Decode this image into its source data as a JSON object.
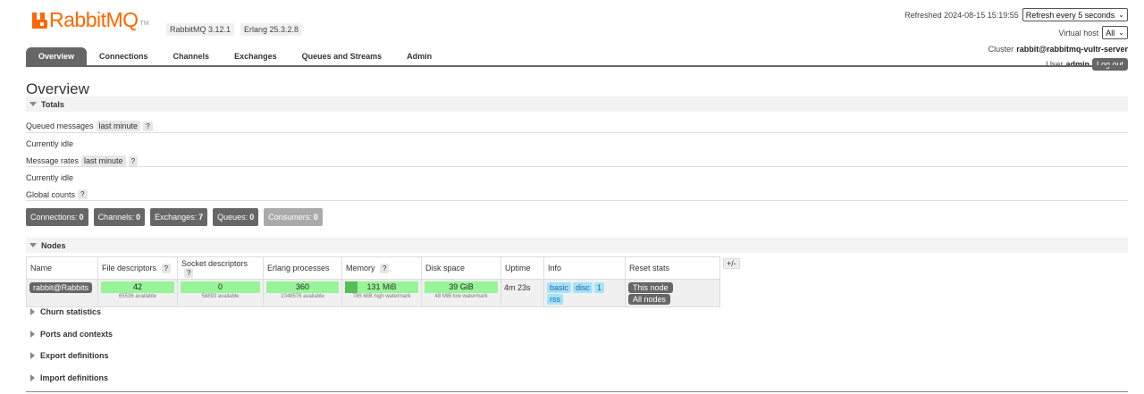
{
  "brand": {
    "name": "RabbitMQ",
    "tm": "TM"
  },
  "versions": {
    "rabbitmq": "RabbitMQ 3.12.1",
    "erlang": "Erlang 25.3.2.8"
  },
  "header": {
    "refreshed_label": "Refreshed",
    "refreshed_time": "2024-08-15 15:19:55",
    "refresh_select": "Refresh every 5 seconds",
    "vhost_label": "Virtual host",
    "vhost_value": "All",
    "cluster_label": "Cluster",
    "cluster_value": "rabbit@rabbitmq-vultr-server",
    "user_label": "User",
    "user_value": "admin",
    "logout": "Log out"
  },
  "tabs": [
    {
      "label": "Overview",
      "active": true
    },
    {
      "label": "Connections"
    },
    {
      "label": "Channels"
    },
    {
      "label": "Exchanges"
    },
    {
      "label": "Queues and Streams"
    },
    {
      "label": "Admin"
    }
  ],
  "page_title": "Overview",
  "totals": {
    "title": "Totals",
    "queued_messages": "Queued messages",
    "queued_range": "last minute",
    "queued_idle": "Currently idle",
    "message_rates": "Message rates",
    "rates_range": "last minute",
    "rates_idle": "Currently idle",
    "global_counts": "Global counts",
    "help": "?"
  },
  "counts": [
    {
      "label": "Connections:",
      "value": "0"
    },
    {
      "label": "Channels:",
      "value": "0"
    },
    {
      "label": "Exchanges:",
      "value": "7"
    },
    {
      "label": "Queues:",
      "value": "0"
    },
    {
      "label": "Consumers:",
      "value": "0"
    }
  ],
  "nodes": {
    "title": "Nodes",
    "headers": [
      "Name",
      "File descriptors",
      "Socket descriptors",
      "Erlang processes",
      "Memory",
      "Disk space",
      "Uptime",
      "Info",
      "Reset stats"
    ],
    "help": "?",
    "plusminus": "+/-",
    "row": {
      "name": "rabbit@Rabbits",
      "fd": "42",
      "fd_sub": "65536 available",
      "sd": "0",
      "sd_sub": "58893 available",
      "ep": "360",
      "ep_sub": "1048576 available",
      "mem": "131 MiB",
      "mem_sub": "785 MiB high watermark",
      "mem_fraction": 0.167,
      "disk": "39 GiB",
      "disk_sub": "48 MiB low watermark",
      "uptime": "4m 23s",
      "info": [
        "basic",
        "disc",
        "1",
        "rss"
      ],
      "reset_this": "This node",
      "reset_all": "All nodes"
    }
  },
  "sections": [
    "Churn statistics",
    "Ports and contexts",
    "Export definitions",
    "Import definitions"
  ]
}
